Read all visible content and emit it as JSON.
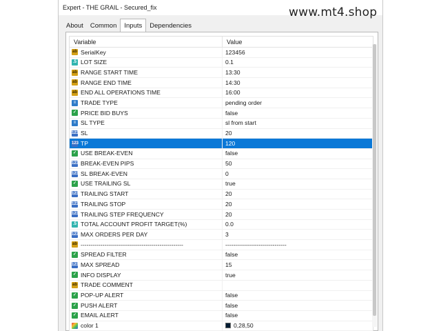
{
  "window": {
    "title": "Expert - THE GRAIL - Secured_fix"
  },
  "watermark": "www.mt4.shop",
  "tabs": [
    {
      "label": "About",
      "active": false
    },
    {
      "label": "Common",
      "active": false
    },
    {
      "label": "Inputs",
      "active": true
    },
    {
      "label": "Dependencies",
      "active": false
    }
  ],
  "table": {
    "headers": [
      "Variable",
      "Value"
    ],
    "rows": [
      {
        "icon": "ab",
        "variable": "SerialKey",
        "value": "123456"
      },
      {
        "icon": "dbl",
        "variable": "LOT SIZE",
        "value": "0.1"
      },
      {
        "icon": "ab",
        "variable": "RANGE START TIME",
        "value": "13:30"
      },
      {
        "icon": "ab",
        "variable": "RANGE END TIME",
        "value": "14:30"
      },
      {
        "icon": "ab",
        "variable": "END ALL OPERATIONS TIME",
        "value": "16:00"
      },
      {
        "icon": "enum",
        "variable": "TRADE TYPE",
        "value": "pending order"
      },
      {
        "icon": "bool",
        "variable": "PRICE BID BUYS",
        "value": "false"
      },
      {
        "icon": "enum",
        "variable": "SL TYPE",
        "value": "sl from start"
      },
      {
        "icon": "num",
        "variable": "SL",
        "value": "20"
      },
      {
        "icon": "num",
        "variable": "TP",
        "value": "120",
        "selected": true
      },
      {
        "icon": "bool",
        "variable": "USE BREAK-EVEN",
        "value": "false"
      },
      {
        "icon": "num",
        "variable": "BREAK-EVEN PIPS",
        "value": "50"
      },
      {
        "icon": "num",
        "variable": "SL BREAK-EVEN",
        "value": "0"
      },
      {
        "icon": "bool",
        "variable": "USE TRAILING SL",
        "value": "true"
      },
      {
        "icon": "num",
        "variable": "TRAILING START",
        "value": "20"
      },
      {
        "icon": "num",
        "variable": "TRAILING STOP",
        "value": "20"
      },
      {
        "icon": "num",
        "variable": "TRAILING STEP FREQUENCY",
        "value": "20"
      },
      {
        "icon": "dbl",
        "variable": "TOTAL ACCOUNT PROFIT TARGET(%)",
        "value": "0.0"
      },
      {
        "icon": "num",
        "variable": "MAX ORDERS PER DAY",
        "value": "3"
      },
      {
        "icon": "ab",
        "variable": "----------------------------------------------------",
        "value": "-------------------------------"
      },
      {
        "icon": "bool",
        "variable": "SPREAD FILTER",
        "value": "false"
      },
      {
        "icon": "num",
        "variable": "MAX SPREAD",
        "value": "15"
      },
      {
        "icon": "bool",
        "variable": "INFO DISPLAY",
        "value": "true"
      },
      {
        "icon": "ab",
        "variable": "TRADE COMMENT",
        "value": ""
      },
      {
        "icon": "bool",
        "variable": "POP-UP ALERT",
        "value": "false"
      },
      {
        "icon": "bool",
        "variable": "PUSH ALERT",
        "value": "false"
      },
      {
        "icon": "bool",
        "variable": "EMAIL ALERT",
        "value": "false"
      },
      {
        "icon": "clr",
        "variable": "color 1",
        "value": "0,28,50",
        "swatch": "#001c32"
      }
    ]
  },
  "colors": {
    "selection": "#0a78d7",
    "panel": "#f0f0f0"
  }
}
